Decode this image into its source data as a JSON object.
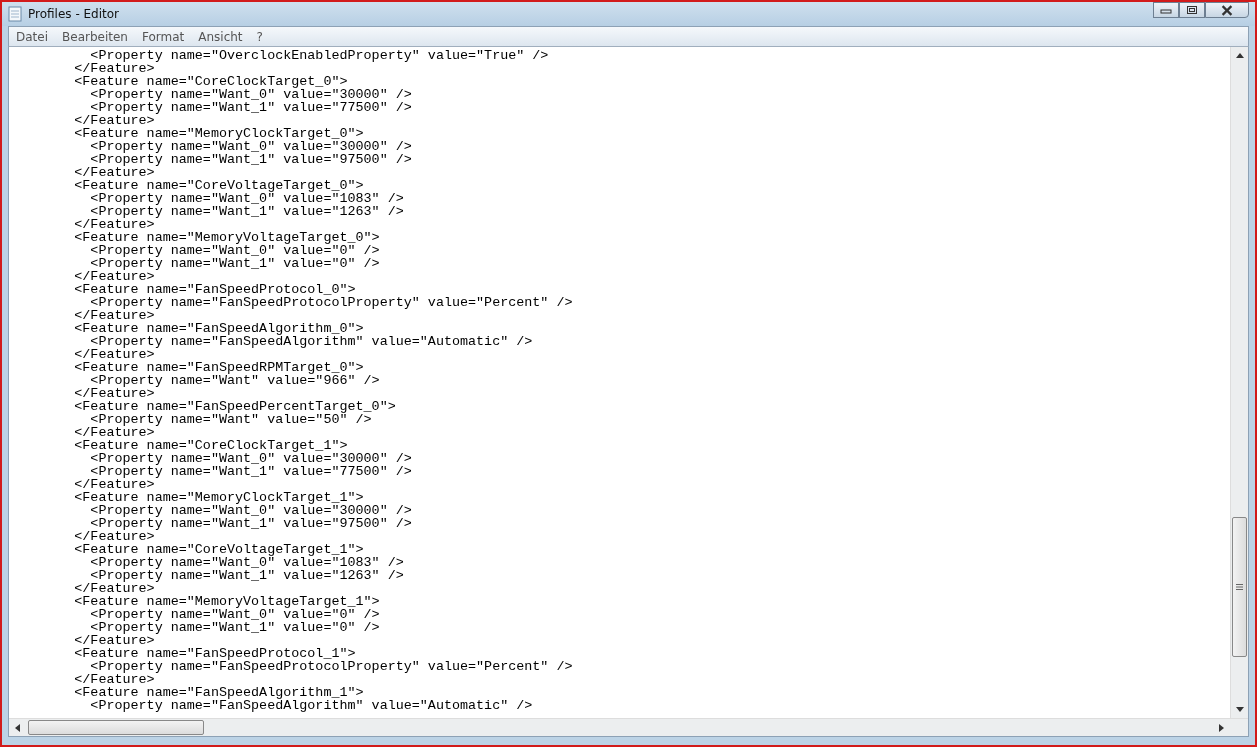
{
  "window": {
    "title": "Profiles - Editor"
  },
  "menu": [
    "Datei",
    "Bearbeiten",
    "Format",
    "Ansicht",
    "?"
  ],
  "editor": {
    "lines": [
      "          <Property name=\"OverclockEnabledProperty\" value=\"True\" />",
      "        </Feature>",
      "        <Feature name=\"CoreClockTarget_0\">",
      "          <Property name=\"Want_0\" value=\"30000\" />",
      "          <Property name=\"Want_1\" value=\"77500\" />",
      "        </Feature>",
      "        <Feature name=\"MemoryClockTarget_0\">",
      "          <Property name=\"Want_0\" value=\"30000\" />",
      "          <Property name=\"Want_1\" value=\"97500\" />",
      "        </Feature>",
      "        <Feature name=\"CoreVoltageTarget_0\">",
      "          <Property name=\"Want_0\" value=\"1083\" />",
      "          <Property name=\"Want_1\" value=\"1263\" />",
      "        </Feature>",
      "        <Feature name=\"MemoryVoltageTarget_0\">",
      "          <Property name=\"Want_0\" value=\"0\" />",
      "          <Property name=\"Want_1\" value=\"0\" />",
      "        </Feature>",
      "        <Feature name=\"FanSpeedProtocol_0\">",
      "          <Property name=\"FanSpeedProtocolProperty\" value=\"Percent\" />",
      "        </Feature>",
      "        <Feature name=\"FanSpeedAlgorithm_0\">",
      "          <Property name=\"FanSpeedAlgorithm\" value=\"Automatic\" />",
      "        </Feature>",
      "        <Feature name=\"FanSpeedRPMTarget_0\">",
      "          <Property name=\"Want\" value=\"966\" />",
      "        </Feature>",
      "        <Feature name=\"FanSpeedPercentTarget_0\">",
      "          <Property name=\"Want\" value=\"50\" />",
      "        </Feature>",
      "        <Feature name=\"CoreClockTarget_1\">",
      "          <Property name=\"Want_0\" value=\"30000\" />",
      "          <Property name=\"Want_1\" value=\"77500\" />",
      "        </Feature>",
      "        <Feature name=\"MemoryClockTarget_1\">",
      "          <Property name=\"Want_0\" value=\"30000\" />",
      "          <Property name=\"Want_1\" value=\"97500\" />",
      "        </Feature>",
      "        <Feature name=\"CoreVoltageTarget_1\">",
      "          <Property name=\"Want_0\" value=\"1083\" />",
      "          <Property name=\"Want_1\" value=\"1263\" />",
      "        </Feature>",
      "        <Feature name=\"MemoryVoltageTarget_1\">",
      "          <Property name=\"Want_0\" value=\"0\" />",
      "          <Property name=\"Want_1\" value=\"0\" />",
      "        </Feature>",
      "        <Feature name=\"FanSpeedProtocol_1\">",
      "          <Property name=\"FanSpeedProtocolProperty\" value=\"Percent\" />",
      "        </Feature>",
      "        <Feature name=\"FanSpeedAlgorithm_1\">",
      "          <Property name=\"FanSpeedAlgorithm\" value=\"Automatic\" />"
    ]
  }
}
